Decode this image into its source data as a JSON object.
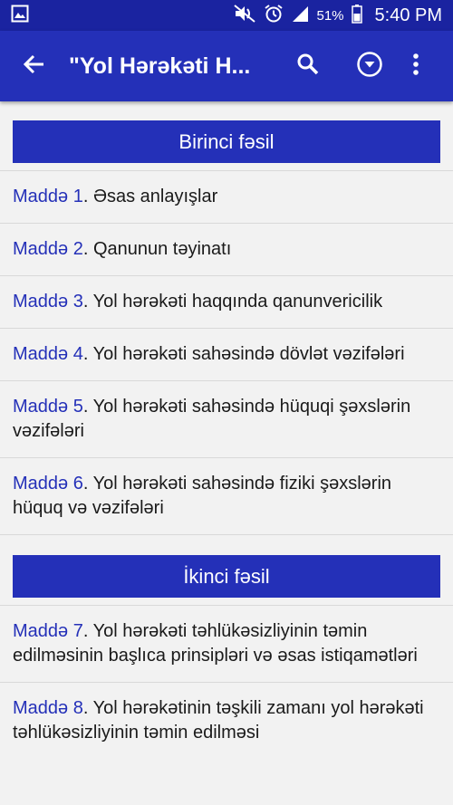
{
  "status_bar": {
    "battery": "51%",
    "time": "5:40 PM"
  },
  "app_bar": {
    "title": "\"Yol Hərəkəti H..."
  },
  "chapters": [
    {
      "title": "Birinci fəsil",
      "articles": [
        {
          "label": "Maddə 1",
          "text": ". Əsas anlayışlar"
        },
        {
          "label": "Maddə 2",
          "text": ". Qanunun təyinatı"
        },
        {
          "label": "Maddə 3",
          "text": ". Yol hərəkəti haqqında qanunvericilik"
        },
        {
          "label": "Maddə 4",
          "text": ". Yol hərəkəti sahəsində dövlət vəzifələri"
        },
        {
          "label": "Maddə 5",
          "text": ". Yol hərəkəti sahəsində hüquqi şəxslərin vəzifələri"
        },
        {
          "label": "Maddə 6",
          "text": ". Yol hərəkəti sahəsində fiziki şəxslərin hüquq və vəzifələri"
        }
      ]
    },
    {
      "title": "İkinci fəsil",
      "articles": [
        {
          "label": "Maddə 7",
          "text": ". Yol hərəkəti təhlükəsizliyinin təmin edilməsinin başlıca prinsipləri və əsas istiqamətləri"
        },
        {
          "label": "Maddə 8",
          "text": ". Yol hərəkətinin təşkili zamanı yol hərəkəti təhlükəsizliyinin təmin edilməsi"
        }
      ]
    }
  ],
  "colors": {
    "primary": "#2430b8",
    "status_bar": "#1a23a0",
    "background": "#f2f2f2",
    "divider": "#d9d9d9"
  }
}
